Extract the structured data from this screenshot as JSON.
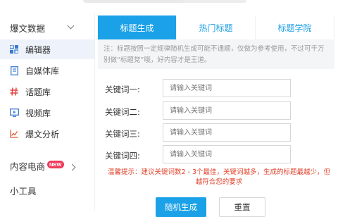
{
  "sidebar": {
    "section_title": "爆文数据",
    "items": [
      {
        "label": "编辑器",
        "icon": "grid-icon",
        "active": true
      },
      {
        "label": "自媒体库",
        "icon": "document-icon"
      },
      {
        "label": "话题库",
        "icon": "hashtag-icon"
      },
      {
        "label": "视频库",
        "icon": "video-icon"
      },
      {
        "label": "爆文分析",
        "icon": "line-chart-icon"
      }
    ],
    "content_ecommerce": "内容电商",
    "new_badge": "NEW",
    "tools": "小工具"
  },
  "tabs": [
    {
      "label": "标题生成",
      "active": true
    },
    {
      "label": "热门标题"
    },
    {
      "label": "标题学院"
    }
  ],
  "notice": "注：标题按照一定规律随机生成可能不通顺，仅做为参考使用，不过可千万别做“标题党”哦，好内容才是王道。",
  "fields": [
    {
      "label": "关键词一:",
      "placeholder": "请输入关键词"
    },
    {
      "label": "关键词二:",
      "placeholder": "请输入关键词"
    },
    {
      "label": "关键词三:",
      "placeholder": "请输入关键词"
    },
    {
      "label": "关键词四:",
      "placeholder": "请输入关键词"
    }
  ],
  "tip": "温馨提示：建议关键词数2 - 3个最佳，关键词越多，生成的标题最越少，但越符合您的要求",
  "buttons": {
    "generate": "随机生成",
    "reset": "重置"
  },
  "colors": {
    "accent": "#1aa1e8",
    "active_sidebar_bg": "#eef3fb",
    "icon": "#3a7ad0",
    "hashtag": "#e64545",
    "chart": "#e05a3a",
    "warning": "#e0452e",
    "badge": "#ee3b5b"
  }
}
